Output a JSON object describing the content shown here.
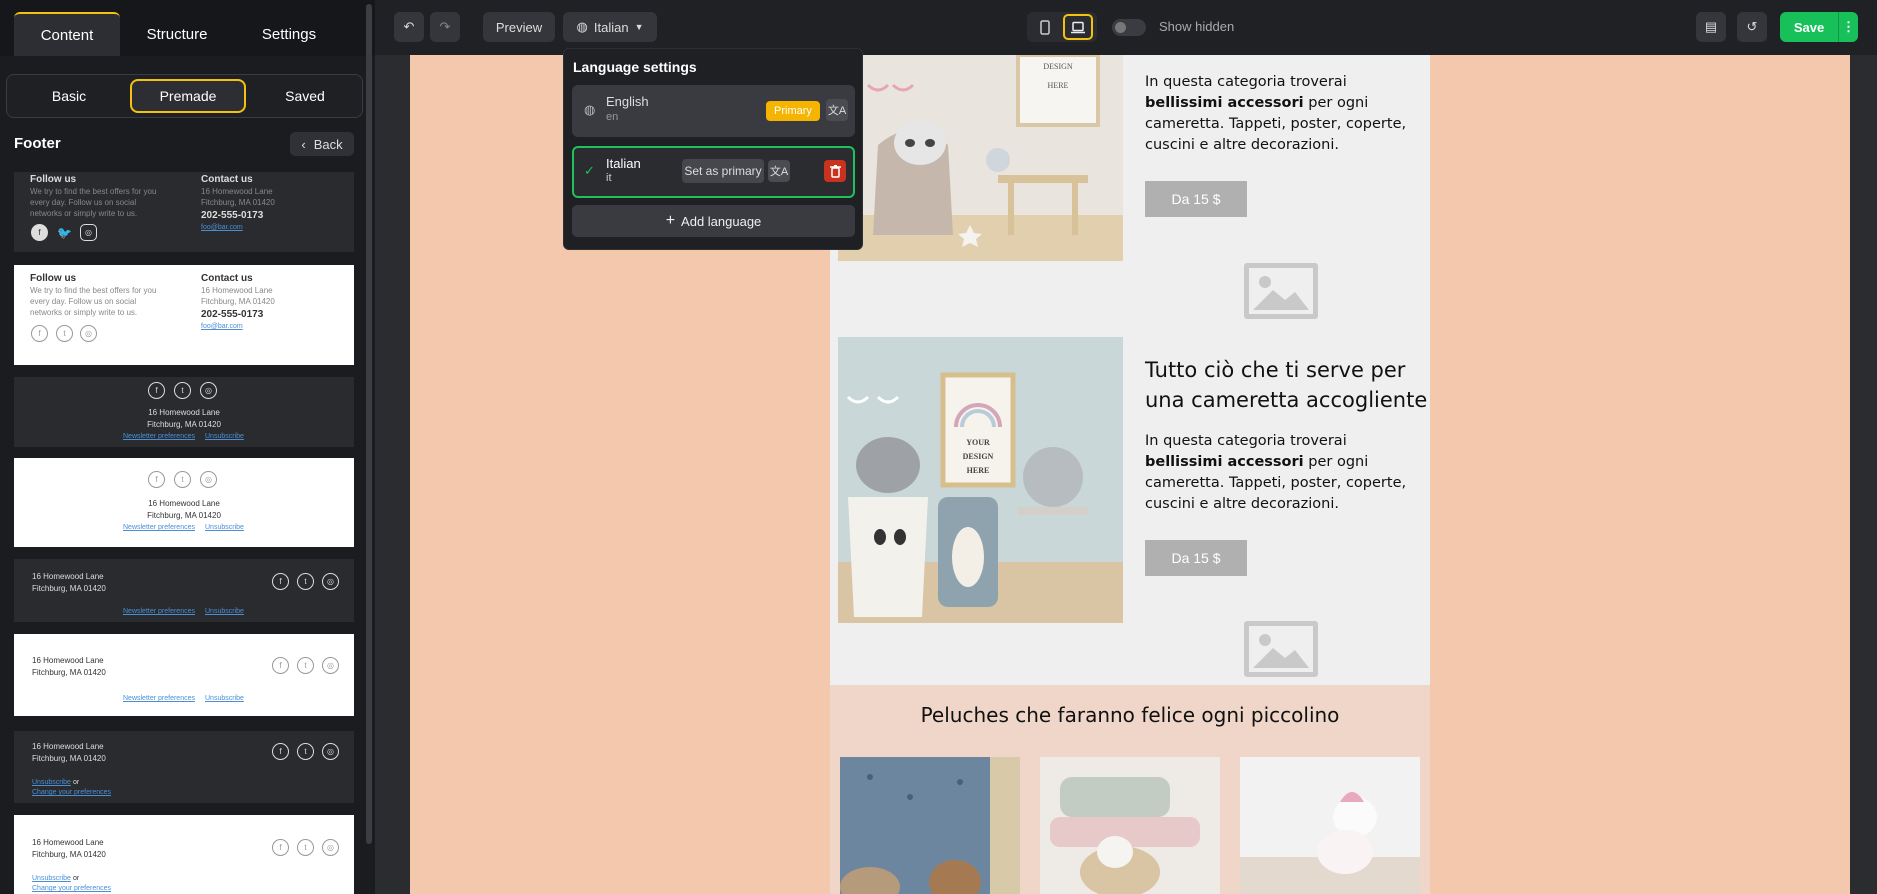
{
  "sidebar": {
    "tabs": [
      "Content",
      "Structure",
      "Settings"
    ],
    "subtabs": [
      "Basic",
      "Premade",
      "Saved"
    ],
    "section_title": "Footer",
    "back_label": "Back",
    "footers": {
      "follow_title": "Follow us",
      "follow_text": [
        "We try to find the best offers for you",
        "every day. Follow us on social",
        "networks or simply write to us."
      ],
      "contact_title": "Contact us",
      "address1": "16 Homewood Lane",
      "address2": "Fitchburg, MA 01420",
      "phone": "202-555-0173",
      "email": "foo@bar.com",
      "newsletter_link": "Newsletter preferences",
      "unsubscribe_link": "Unsubscribe",
      "or_text": "or",
      "change_link": "Change your preferences"
    }
  },
  "topbar": {
    "preview_label": "Preview",
    "language_label": "Italian",
    "show_hidden_label": "Show hidden",
    "save_label": "Save"
  },
  "language_popover": {
    "title": "Language settings",
    "languages": [
      {
        "name": "English",
        "code": "en",
        "badge": "Primary"
      },
      {
        "name": "Italian",
        "code": "it",
        "action": "Set as primary"
      }
    ],
    "add_label": "Add language"
  },
  "email": {
    "block1": {
      "photo_text": [
        "DESIGN",
        "HERE"
      ],
      "para": [
        "In questa categoria troverai",
        "bellissimi accessori",
        " per ogni",
        "cameretta. Tappeti, poster, coperte,",
        "cuscini e altre decorazioni."
      ],
      "cta": "Da 15 $"
    },
    "block2": {
      "photo_text": [
        "YOUR",
        "DESIGN",
        "HERE"
      ],
      "title": [
        "Tutto ciò che ti serve per",
        "una cameretta accogliente"
      ],
      "para": [
        "In questa categoria troverai",
        "bellissimi accessori",
        " per ogni",
        "cameretta. Tappeti, poster, coperte,",
        "cuscini e altre decorazioni."
      ],
      "cta": "Da 15 $"
    },
    "peluches_title": "Peluches che faranno felice ogni piccolino"
  },
  "colors": {
    "accent": "#f4c20d",
    "save": "#18c05a",
    "email_bg": "#f4c8ad",
    "delete": "#c8321e"
  }
}
